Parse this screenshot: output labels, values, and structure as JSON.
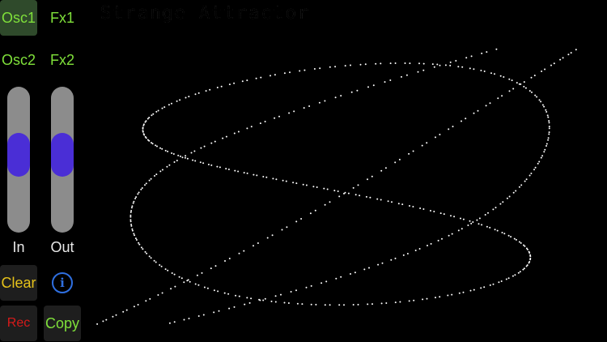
{
  "buttons": {
    "osc1": {
      "label": "Osc1",
      "color": "#7fe03a",
      "state": "active"
    },
    "fx1": {
      "label": "Fx1",
      "color": "#7fe03a"
    },
    "osc2": {
      "label": "Osc2",
      "color": "#7fe03a"
    },
    "fx2": {
      "label": "Fx2",
      "color": "#7fe03a"
    },
    "clear": {
      "label": "Clear",
      "color": "#e6c21a"
    },
    "info": {
      "label": "i",
      "icon": "info-icon",
      "color": "#2f6fe0"
    },
    "rec": {
      "label": "Rec",
      "color": "#d61a1a"
    },
    "copy": {
      "label": "Copy",
      "color": "#7fe03a"
    }
  },
  "sliders": {
    "in": {
      "label": "In",
      "level": 0.55
    },
    "out": {
      "label": "Out",
      "level": 0.55
    }
  },
  "scope": {
    "title": "Strange Attractor",
    "point_color": "#ffffff",
    "background": "#000000"
  }
}
